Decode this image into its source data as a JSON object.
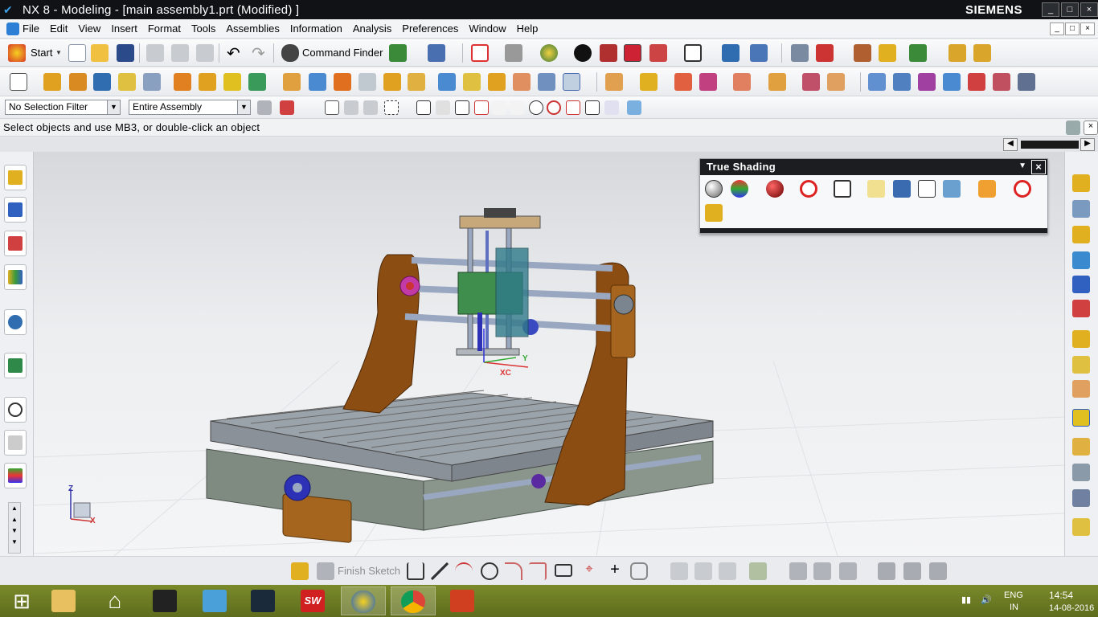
{
  "window": {
    "title": "NX 8 - Modeling - [main assembly1.prt (Modified) ]",
    "brand": "SIEMENS",
    "controls": [
      "_",
      "□",
      "×"
    ]
  },
  "menu": {
    "items": [
      "File",
      "Edit",
      "View",
      "Insert",
      "Format",
      "Tools",
      "Assemblies",
      "Information",
      "Analysis",
      "Preferences",
      "Window",
      "Help"
    ],
    "doc_controls": [
      "_",
      "□",
      "×"
    ]
  },
  "toolbar": {
    "start_label": "Start",
    "command_finder_label": "Command Finder"
  },
  "selection": {
    "filter_value": "No Selection Filter",
    "scope_value": "Entire Assembly"
  },
  "cue_line": {
    "text": "Select objects and use MB3, or double-click an object"
  },
  "true_shading": {
    "title": "True Shading",
    "close_label": "×"
  },
  "viewport": {
    "wcs_labels": {
      "z": "Z",
      "x": "X",
      "y": "Y",
      "xc": "XC",
      "yc": "Y"
    },
    "colors": {
      "frame": "#d6d8dc",
      "side_plates": "#8c4d12",
      "base": "#7f8a80",
      "rails": "#9aa7c0",
      "carriage": "#3f8e4d",
      "pulley": "#2c31b5"
    }
  },
  "sketch_toolbar": {
    "finish_sketch_label": "Finish Sketch"
  },
  "taskbar": {
    "apps": [
      "windows-start",
      "file-explorer",
      "internet-explorer",
      "game-app",
      "remote-desktop",
      "3ds-max",
      "solidworks",
      "siemens-nx",
      "chrome",
      "office-app"
    ],
    "tray": {
      "lang": "ENG",
      "region": "IN",
      "time": "14:54",
      "date": "14-08-2016"
    }
  }
}
